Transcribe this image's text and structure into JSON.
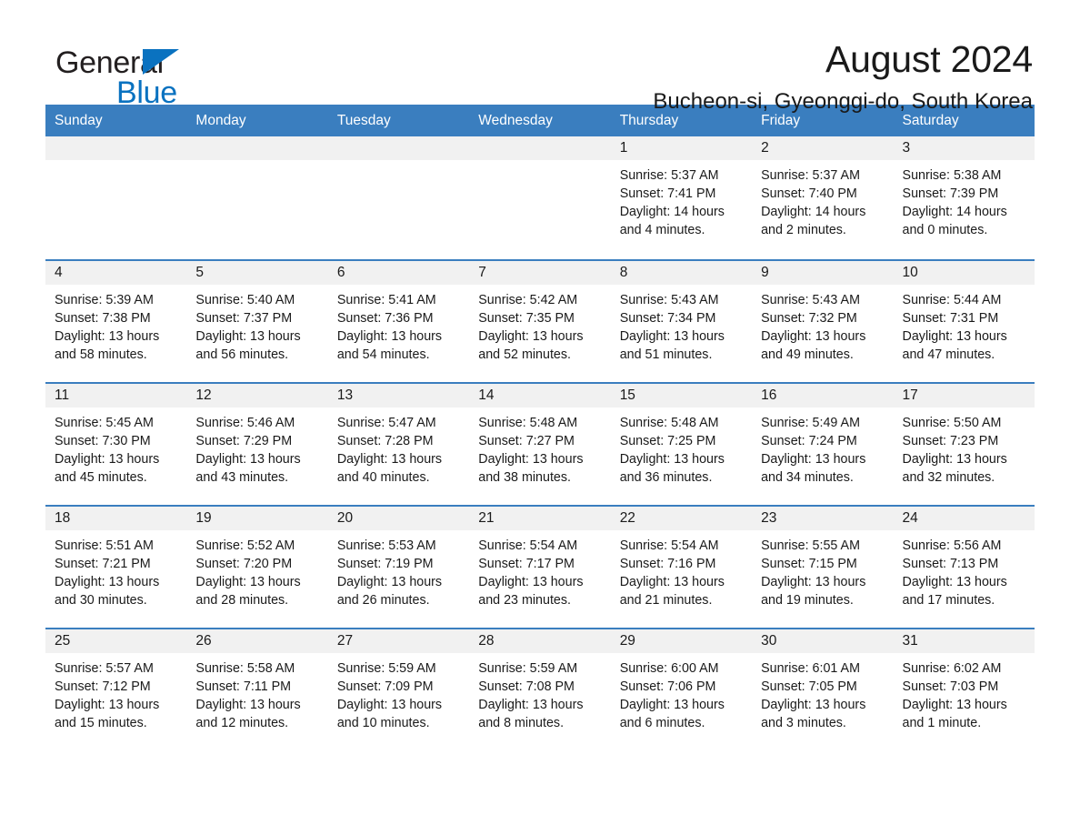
{
  "brand": {
    "name_part1": "General",
    "name_part2": "Blue",
    "accent_color": "#0a72c0"
  },
  "header": {
    "title": "August 2024",
    "location": "Bucheon-si, Gyeonggi-do, South Korea"
  },
  "calendar": {
    "header_color": "#3a7ebf",
    "weekdays": [
      "Sunday",
      "Monday",
      "Tuesday",
      "Wednesday",
      "Thursday",
      "Friday",
      "Saturday"
    ],
    "weeks": [
      [
        {
          "day": "",
          "empty": true
        },
        {
          "day": "",
          "empty": true
        },
        {
          "day": "",
          "empty": true
        },
        {
          "day": "",
          "empty": true
        },
        {
          "day": "1",
          "sunrise": "Sunrise: 5:37 AM",
          "sunset": "Sunset: 7:41 PM",
          "daylight": "Daylight: 14 hours and 4 minutes."
        },
        {
          "day": "2",
          "sunrise": "Sunrise: 5:37 AM",
          "sunset": "Sunset: 7:40 PM",
          "daylight": "Daylight: 14 hours and 2 minutes."
        },
        {
          "day": "3",
          "sunrise": "Sunrise: 5:38 AM",
          "sunset": "Sunset: 7:39 PM",
          "daylight": "Daylight: 14 hours and 0 minutes."
        }
      ],
      [
        {
          "day": "4",
          "sunrise": "Sunrise: 5:39 AM",
          "sunset": "Sunset: 7:38 PM",
          "daylight": "Daylight: 13 hours and 58 minutes."
        },
        {
          "day": "5",
          "sunrise": "Sunrise: 5:40 AM",
          "sunset": "Sunset: 7:37 PM",
          "daylight": "Daylight: 13 hours and 56 minutes."
        },
        {
          "day": "6",
          "sunrise": "Sunrise: 5:41 AM",
          "sunset": "Sunset: 7:36 PM",
          "daylight": "Daylight: 13 hours and 54 minutes."
        },
        {
          "day": "7",
          "sunrise": "Sunrise: 5:42 AM",
          "sunset": "Sunset: 7:35 PM",
          "daylight": "Daylight: 13 hours and 52 minutes."
        },
        {
          "day": "8",
          "sunrise": "Sunrise: 5:43 AM",
          "sunset": "Sunset: 7:34 PM",
          "daylight": "Daylight: 13 hours and 51 minutes."
        },
        {
          "day": "9",
          "sunrise": "Sunrise: 5:43 AM",
          "sunset": "Sunset: 7:32 PM",
          "daylight": "Daylight: 13 hours and 49 minutes."
        },
        {
          "day": "10",
          "sunrise": "Sunrise: 5:44 AM",
          "sunset": "Sunset: 7:31 PM",
          "daylight": "Daylight: 13 hours and 47 minutes."
        }
      ],
      [
        {
          "day": "11",
          "sunrise": "Sunrise: 5:45 AM",
          "sunset": "Sunset: 7:30 PM",
          "daylight": "Daylight: 13 hours and 45 minutes."
        },
        {
          "day": "12",
          "sunrise": "Sunrise: 5:46 AM",
          "sunset": "Sunset: 7:29 PM",
          "daylight": "Daylight: 13 hours and 43 minutes."
        },
        {
          "day": "13",
          "sunrise": "Sunrise: 5:47 AM",
          "sunset": "Sunset: 7:28 PM",
          "daylight": "Daylight: 13 hours and 40 minutes."
        },
        {
          "day": "14",
          "sunrise": "Sunrise: 5:48 AM",
          "sunset": "Sunset: 7:27 PM",
          "daylight": "Daylight: 13 hours and 38 minutes."
        },
        {
          "day": "15",
          "sunrise": "Sunrise: 5:48 AM",
          "sunset": "Sunset: 7:25 PM",
          "daylight": "Daylight: 13 hours and 36 minutes."
        },
        {
          "day": "16",
          "sunrise": "Sunrise: 5:49 AM",
          "sunset": "Sunset: 7:24 PM",
          "daylight": "Daylight: 13 hours and 34 minutes."
        },
        {
          "day": "17",
          "sunrise": "Sunrise: 5:50 AM",
          "sunset": "Sunset: 7:23 PM",
          "daylight": "Daylight: 13 hours and 32 minutes."
        }
      ],
      [
        {
          "day": "18",
          "sunrise": "Sunrise: 5:51 AM",
          "sunset": "Sunset: 7:21 PM",
          "daylight": "Daylight: 13 hours and 30 minutes."
        },
        {
          "day": "19",
          "sunrise": "Sunrise: 5:52 AM",
          "sunset": "Sunset: 7:20 PM",
          "daylight": "Daylight: 13 hours and 28 minutes."
        },
        {
          "day": "20",
          "sunrise": "Sunrise: 5:53 AM",
          "sunset": "Sunset: 7:19 PM",
          "daylight": "Daylight: 13 hours and 26 minutes."
        },
        {
          "day": "21",
          "sunrise": "Sunrise: 5:54 AM",
          "sunset": "Sunset: 7:17 PM",
          "daylight": "Daylight: 13 hours and 23 minutes."
        },
        {
          "day": "22",
          "sunrise": "Sunrise: 5:54 AM",
          "sunset": "Sunset: 7:16 PM",
          "daylight": "Daylight: 13 hours and 21 minutes."
        },
        {
          "day": "23",
          "sunrise": "Sunrise: 5:55 AM",
          "sunset": "Sunset: 7:15 PM",
          "daylight": "Daylight: 13 hours and 19 minutes."
        },
        {
          "day": "24",
          "sunrise": "Sunrise: 5:56 AM",
          "sunset": "Sunset: 7:13 PM",
          "daylight": "Daylight: 13 hours and 17 minutes."
        }
      ],
      [
        {
          "day": "25",
          "sunrise": "Sunrise: 5:57 AM",
          "sunset": "Sunset: 7:12 PM",
          "daylight": "Daylight: 13 hours and 15 minutes."
        },
        {
          "day": "26",
          "sunrise": "Sunrise: 5:58 AM",
          "sunset": "Sunset: 7:11 PM",
          "daylight": "Daylight: 13 hours and 12 minutes."
        },
        {
          "day": "27",
          "sunrise": "Sunrise: 5:59 AM",
          "sunset": "Sunset: 7:09 PM",
          "daylight": "Daylight: 13 hours and 10 minutes."
        },
        {
          "day": "28",
          "sunrise": "Sunrise: 5:59 AM",
          "sunset": "Sunset: 7:08 PM",
          "daylight": "Daylight: 13 hours and 8 minutes."
        },
        {
          "day": "29",
          "sunrise": "Sunrise: 6:00 AM",
          "sunset": "Sunset: 7:06 PM",
          "daylight": "Daylight: 13 hours and 6 minutes."
        },
        {
          "day": "30",
          "sunrise": "Sunrise: 6:01 AM",
          "sunset": "Sunset: 7:05 PM",
          "daylight": "Daylight: 13 hours and 3 minutes."
        },
        {
          "day": "31",
          "sunrise": "Sunrise: 6:02 AM",
          "sunset": "Sunset: 7:03 PM",
          "daylight": "Daylight: 13 hours and 1 minute."
        }
      ]
    ]
  }
}
